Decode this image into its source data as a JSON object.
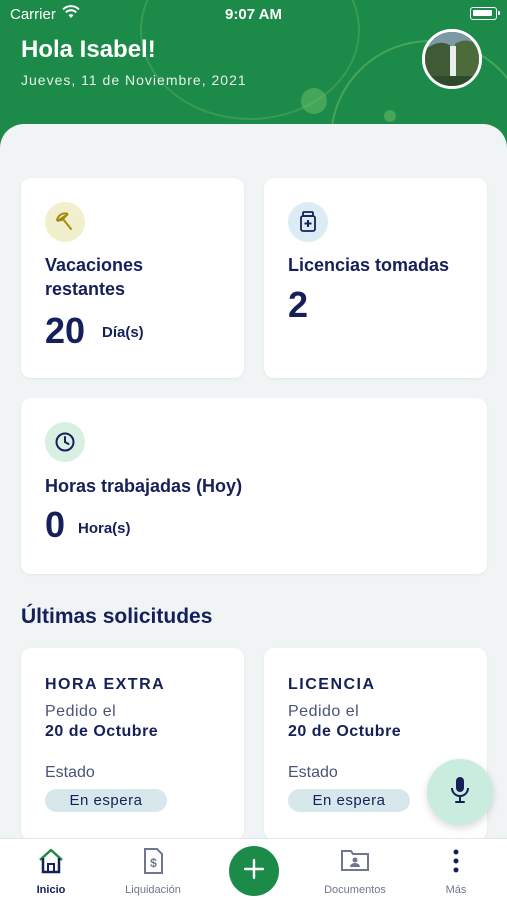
{
  "status_bar": {
    "carrier": "Carrier",
    "time": "9:07 AM"
  },
  "header": {
    "greeting": "Hola Isabel!",
    "date": "Jueves, 11 de Noviembre, 2021"
  },
  "cards": {
    "vacaciones": {
      "title": "Vacaciones restantes",
      "value": "20",
      "unit": "Día(s)",
      "icon": "umbrella-icon"
    },
    "licencias": {
      "title": "Licencias tomadas",
      "value": "2",
      "icon": "medical-kit-icon"
    },
    "horas": {
      "title": "Horas trabajadas (Hoy)",
      "value": "0",
      "unit": "Hora(s)",
      "icon": "clock-icon"
    }
  },
  "requests_section": {
    "title": "Últimas solicitudes",
    "items": [
      {
        "type": "HORA EXTRA",
        "requested_label": "Pedido el",
        "requested_date": "20 de Octubre",
        "status_label": "Estado",
        "status": "En espera"
      },
      {
        "type": "LICENCIA",
        "requested_label": "Pedido el",
        "requested_date": "20 de Octubre",
        "status_label": "Estado",
        "status": "En espera"
      }
    ]
  },
  "tabbar": {
    "tabs": [
      {
        "label": "Inicio",
        "icon": "home-icon",
        "active": true
      },
      {
        "label": "Liquidación",
        "icon": "payroll-document-icon"
      },
      {
        "label": "Documentos",
        "icon": "folder-user-icon"
      },
      {
        "label": "Más",
        "icon": "more-vertical-icon"
      }
    ],
    "fab_icon": "plus-icon"
  },
  "colors": {
    "brand_green": "#1c8a48",
    "navy": "#15205a",
    "badge_bg": "#d7e8ec",
    "mic_bg": "#c9ecde"
  }
}
